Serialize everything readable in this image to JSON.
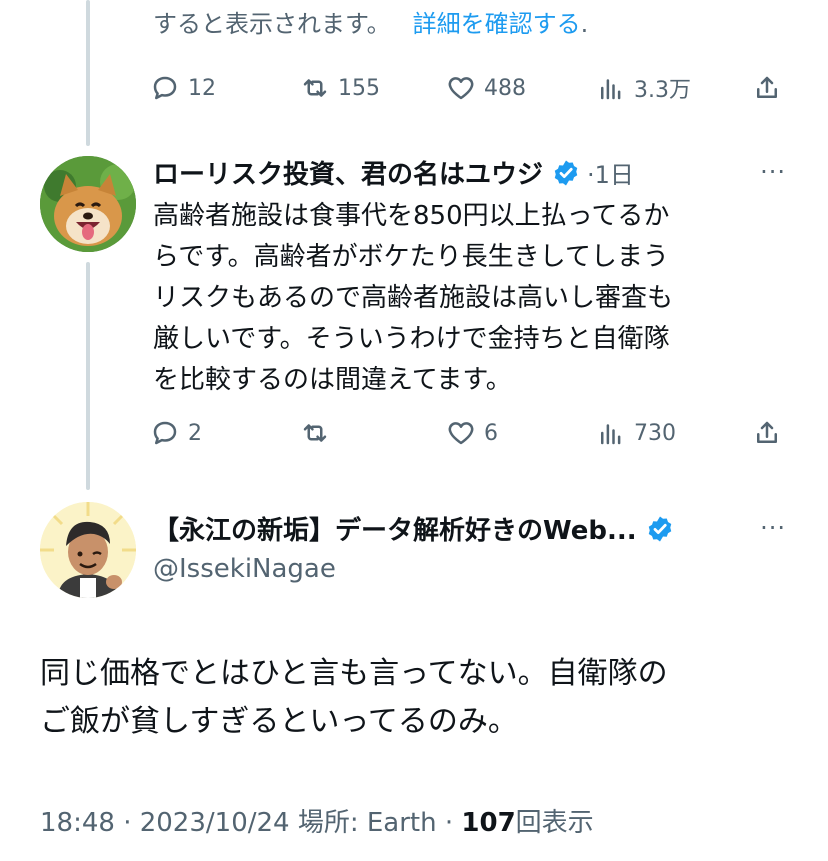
{
  "prev_tweet": {
    "text_fragment": "すると表示されます。",
    "link_text": "詳細を確認する",
    "tail": ".",
    "actions": {
      "replies": "12",
      "retweets": "155",
      "likes": "488",
      "views": "3.3万"
    }
  },
  "reply_tweet": {
    "display_name": "ローリスク投資、君の名はユウジ",
    "time": "·1日",
    "more": "···",
    "text_lines": [
      "高齢者施設は食事代を850円以上払ってるか",
      "らです。高齢者がボケたり長生きしてしまう",
      "リスクもあるので高齢者施設は高いし審査も",
      "厳しいです。そういうわけで金持ちと自衛隊",
      "を比較するのは間違えてます。"
    ],
    "actions": {
      "replies": "2",
      "retweets": "",
      "likes": "6",
      "views": "730"
    }
  },
  "focus_tweet": {
    "display_name": "【永江の新垢】データ解析好きのWeb...",
    "handle": "@IssekiNagae",
    "more": "···",
    "text_lines": [
      "同じ価格でとはひと言も言ってない。自衛隊の",
      "ご飯が貧しすぎるといってるのみ。"
    ],
    "footer": {
      "time": "18:48 · 2023/10/24 場所: Earth · ",
      "view_count": "107",
      "view_label": "回表示"
    }
  },
  "colors": {
    "accent": "#1d9bf0",
    "muted": "#536471",
    "thread_line": "#cfd9de"
  }
}
